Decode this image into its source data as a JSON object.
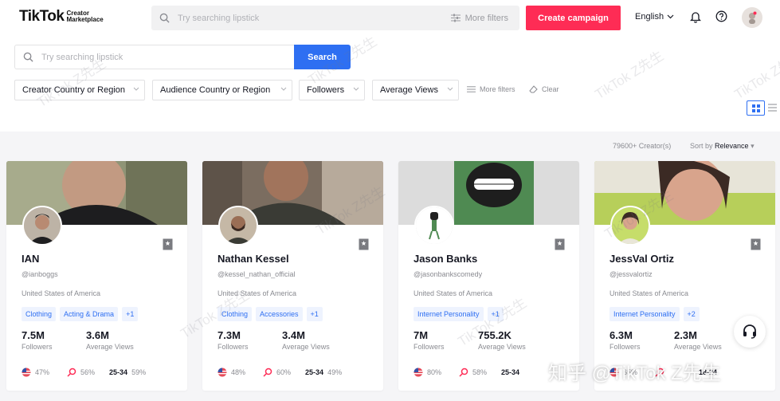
{
  "brand": {
    "name": "TikTok",
    "sub_line1": "Creator",
    "sub_line2": "Marketplace"
  },
  "top_search": {
    "placeholder": "Try searching lipstick",
    "more_filters": "More filters"
  },
  "create_campaign": "Create campaign",
  "language": "English",
  "filters": {
    "search_placeholder": "Try searching lipstick",
    "search_button": "Search",
    "dropdowns": [
      "Creator Country or Region",
      "Audience Country or Region",
      "Followers",
      "Average Views"
    ],
    "more_filters": "More filters",
    "clear": "Clear"
  },
  "results": {
    "count": "79600+ Creator(s)",
    "sort_prefix": "Sort by",
    "sort_value": "Relevance"
  },
  "creators": [
    {
      "name": "IAN",
      "handle": "@ianboggs",
      "country": "United States of America",
      "tags": [
        "Clothing",
        "Acting & Drama",
        "+1"
      ],
      "followers": "7.5M",
      "followers_label": "Followers",
      "views": "3.6M",
      "views_label": "Average Views",
      "country_pct": "47%",
      "gender_pct": "56%",
      "age": "25-34",
      "age_pct": "59%"
    },
    {
      "name": "Nathan Kessel",
      "handle": "@kessel_nathan_official",
      "country": "United States of America",
      "tags": [
        "Clothing",
        "Accessories",
        "+1"
      ],
      "followers": "7.3M",
      "followers_label": "Followers",
      "views": "3.4M",
      "views_label": "Average Views",
      "country_pct": "48%",
      "gender_pct": "60%",
      "age": "25-34",
      "age_pct": "49%"
    },
    {
      "name": "Jason Banks",
      "handle": "@jasonbankscomedy",
      "country": "United States of America",
      "tags": [
        "Internet Personality",
        "+1"
      ],
      "followers": "7M",
      "followers_label": "Followers",
      "views": "755.2K",
      "views_label": "Average Views",
      "country_pct": "80%",
      "gender_pct": "58%",
      "age": "25-34",
      "age_pct": ""
    },
    {
      "name": "JessVal Ortiz",
      "handle": "@jessvalortiz",
      "country": "United States of America",
      "tags": [
        "Internet Personality",
        "+2"
      ],
      "followers": "6.3M",
      "followers_label": "Followers",
      "views": "2.3M",
      "views_label": "Average Views",
      "country_pct": "65%",
      "gender_pct": "",
      "age": "18-24",
      "age_pct": ""
    }
  ],
  "watermark": {
    "small": "TikTok Z先生",
    "big": "知乎 @TikTok Z先生"
  },
  "colors": {
    "accent_red": "#fe2c55",
    "accent_blue": "#2e6ff2"
  }
}
